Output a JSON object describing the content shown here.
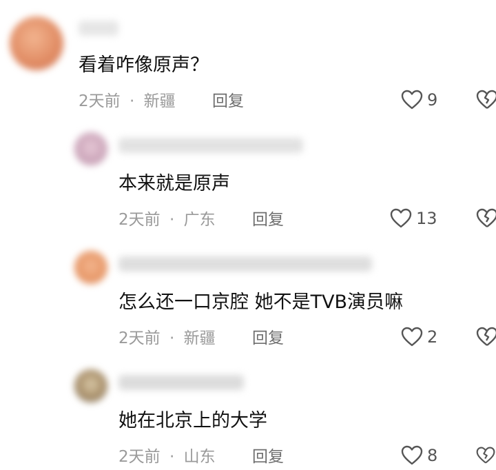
{
  "colors": {
    "text": "#111111",
    "meta": "#9a9a9a",
    "icon": "#555555"
  },
  "comments": [
    {
      "text": "看着咋像原声？",
      "time": "2天前",
      "sep": "·",
      "location": "新疆",
      "reply": "回复",
      "likes": "9"
    },
    {
      "text": "本来就是原声",
      "time": "2天前",
      "sep": "·",
      "location": "广东",
      "reply": "回复",
      "likes": "13"
    },
    {
      "text": "怎么还一口京腔 她不是TVB演员嘛",
      "time": "2天前",
      "sep": "·",
      "location": "新疆",
      "reply": "回复",
      "likes": "2"
    },
    {
      "text": "她在北京上的大学",
      "time": "2天前",
      "sep": "·",
      "location": "山东",
      "reply": "回复",
      "likes": "8"
    }
  ]
}
